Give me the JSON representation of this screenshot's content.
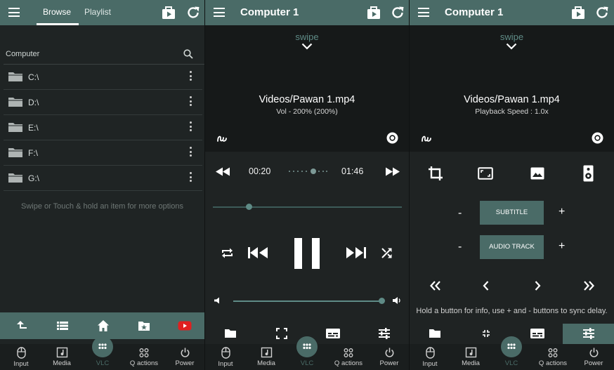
{
  "browse_panel": {
    "tabs": [
      "Browse",
      "Playlist"
    ],
    "location_label": "Computer",
    "drives": [
      "C:\\",
      "D:\\",
      "E:\\",
      "F:\\",
      "G:\\"
    ],
    "hint": "Swipe or Touch & hold an item for more options"
  },
  "player_panel": {
    "title": "Computer 1",
    "swipe_label": "swipe",
    "file": "Videos/Pawan 1.mp4",
    "volume_text": "Vol - 200% (200%)",
    "elapsed": "00:20",
    "duration": "01:46",
    "progress_fraction": 0.19,
    "volume_fraction": 1.0
  },
  "sync_panel": {
    "title": "Computer 1",
    "swipe_label": "swipe",
    "file": "Videos/Pawan 1.mp4",
    "speed_text": "Playback Speed : 1.0x",
    "subtitle_label": "SUBTITLE",
    "audio_label": "AUDIO TRACK",
    "minus": "-",
    "plus": "+",
    "help": "Hold a button for info, use + and - buttons to sync delay."
  },
  "bottom_nav": [
    "Input",
    "Media",
    "VLC",
    "Q actions",
    "Power"
  ],
  "colors": {
    "accent": "#4a6b67",
    "accent_light": "#5f8b86",
    "background": "#1f2424",
    "youtube_red": "#e02020"
  }
}
